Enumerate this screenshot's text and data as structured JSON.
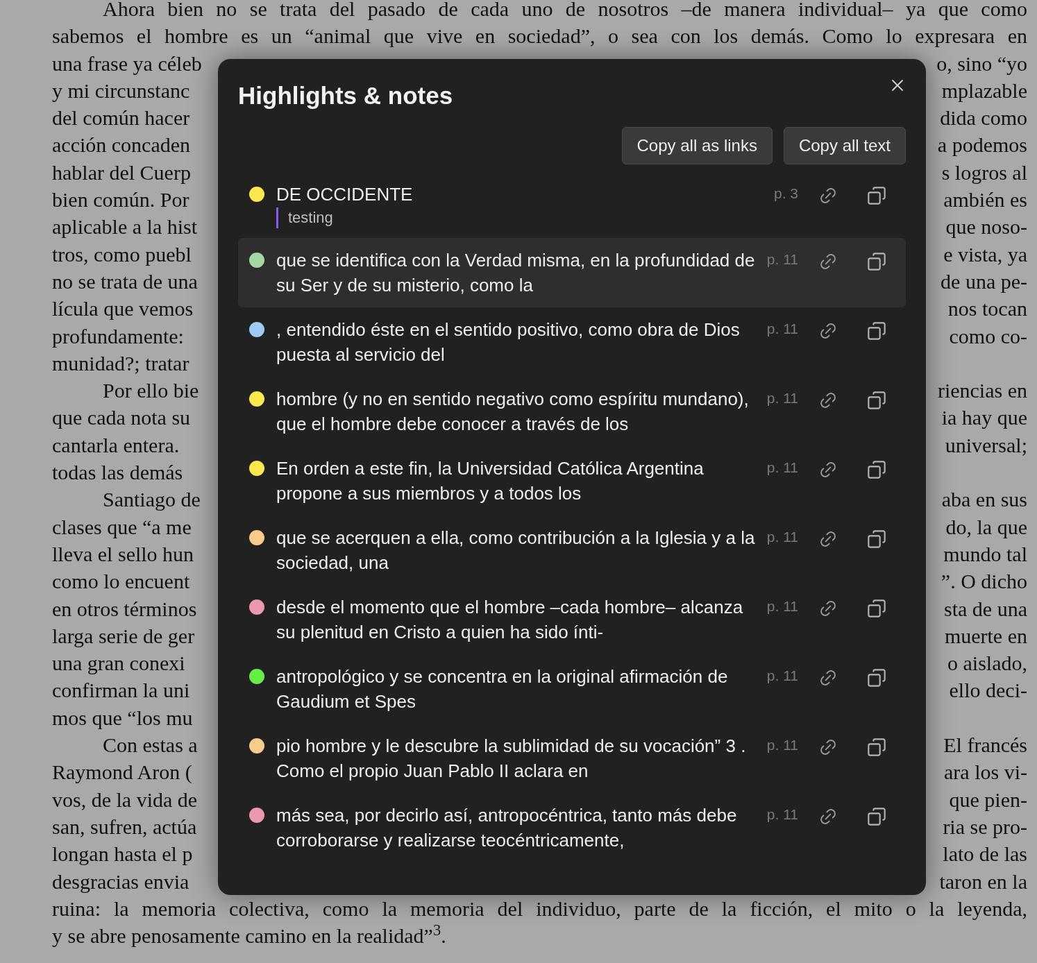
{
  "document": {
    "lines": [
      {
        "kind": "full",
        "indent": true,
        "text": "Ahora bien no se trata del pasado de cada uno de nosotros –de manera individual– ya que como"
      },
      {
        "kind": "full",
        "indent": false,
        "text": "sabemos el hombre es un “animal que vive en sociedad”, o sea con los demás. Como lo expresara en"
      },
      {
        "kind": "split",
        "indent": false,
        "left": "una frase ya céleb",
        "right": "o, sino “yo"
      },
      {
        "kind": "split",
        "indent": false,
        "left": "y mi circunstanc",
        "right": "mplazable"
      },
      {
        "kind": "split",
        "indent": false,
        "left": "del común hacer",
        "right": "dida como"
      },
      {
        "kind": "split",
        "indent": false,
        "left": "acción concaden",
        "right": "a podemos"
      },
      {
        "kind": "split",
        "indent": false,
        "left": "hablar del Cuerp",
        "right": "s logros al"
      },
      {
        "kind": "split",
        "indent": false,
        "left": "bien común. Por",
        "right": "ambién es"
      },
      {
        "kind": "split",
        "indent": false,
        "left": "aplicable a la hist",
        "right": "que noso-"
      },
      {
        "kind": "split",
        "indent": false,
        "left": "tros, como puebl",
        "right": "e vista, ya"
      },
      {
        "kind": "split",
        "indent": false,
        "left": "no se trata de una",
        "right": "de una pe-"
      },
      {
        "kind": "split",
        "indent": false,
        "left": "lícula que vemos",
        "right": "nos tocan"
      },
      {
        "kind": "split",
        "indent": false,
        "left": "profundamente:",
        "right": "como co-"
      },
      {
        "kind": "split",
        "indent": false,
        "left": "munidad?; tratar"
      },
      {
        "kind": "split",
        "indent": true,
        "left": "Por ello bie",
        "right": "riencias en"
      },
      {
        "kind": "split",
        "indent": false,
        "left": "que cada nota su",
        "right": "ia hay que"
      },
      {
        "kind": "split",
        "indent": false,
        "left": "cantarla entera.",
        "right": "universal;"
      },
      {
        "kind": "split",
        "indent": false,
        "left": "todas las demás"
      },
      {
        "kind": "split",
        "indent": true,
        "left": "Santiago de",
        "right": "aba en sus"
      },
      {
        "kind": "split",
        "indent": false,
        "left": "clases que “a me",
        "right": "do, la que"
      },
      {
        "kind": "split",
        "indent": false,
        "left": "lleva el sello hun",
        "right": "mundo tal"
      },
      {
        "kind": "split",
        "indent": false,
        "left": "como lo encuent",
        "right": "”. O dicho"
      },
      {
        "kind": "split",
        "indent": false,
        "left": "en otros términos",
        "right": "sta de una"
      },
      {
        "kind": "split",
        "indent": false,
        "left": "larga serie de ger",
        "right": "muerte en"
      },
      {
        "kind": "split",
        "indent": false,
        "left": "una gran conexi",
        "right": "o aislado,"
      },
      {
        "kind": "split",
        "indent": false,
        "left": "confirman la uni",
        "right": "ello deci-"
      },
      {
        "kind": "split",
        "indent": false,
        "left": "mos que “los mu"
      },
      {
        "kind": "split",
        "indent": true,
        "left": "Con estas a",
        "right": "El francés"
      },
      {
        "kind": "split",
        "indent": false,
        "left": "Raymond Aron (",
        "right": "ara los vi-"
      },
      {
        "kind": "split",
        "indent": false,
        "left": "vos, de la vida de",
        "right": "que pien-"
      },
      {
        "kind": "split",
        "indent": false,
        "left": "san, sufren, actúa",
        "right": "ria se pro-"
      },
      {
        "kind": "split",
        "indent": false,
        "left": "longan hasta el p",
        "right": "lato de las"
      },
      {
        "kind": "split",
        "indent": false,
        "left": "desgracias envia",
        "right": "taron en la"
      },
      {
        "kind": "full",
        "indent": false,
        "text": "ruina: la memoria colectiva, como la memoria del individuo, parte de la ficción, el mito o la leyenda,"
      },
      {
        "kind": "last",
        "indent": false,
        "text": "y se abre penosamente camino en la realidad”$^{3}$."
      }
    ]
  },
  "dialog": {
    "title": "Highlights & notes",
    "buttons": [
      "Copy all as links",
      "Copy all text"
    ],
    "highlights": [
      {
        "text": "DE OCCIDENTE",
        "note": "testing",
        "page": "p. 3",
        "color": "#fbe84e",
        "selected": false
      },
      {
        "text": "que se identifica con la Verdad misma, en la profundidad de su Ser y de su misterio, como la",
        "page": "p. 11",
        "color": "#a6d6a3",
        "selected": true
      },
      {
        "text": ", entendido éste en el sentido positivo, como obra de Dios puesta al servicio del",
        "page": "p. 11",
        "color": "#9dcbf6",
        "selected": false
      },
      {
        "text": "hombre (y no en sentido negativo como espíritu mundano), que el hombre debe conocer a través de los",
        "page": "p. 11",
        "color": "#fbe84e",
        "selected": false
      },
      {
        "text": "En orden a este fin, la Universidad Católica Argentina propone a sus miembros y a todos los",
        "page": "p. 11",
        "color": "#fbe84e",
        "selected": false
      },
      {
        "text": "que se acerquen a ella, como contribución a la Iglesia y a la sociedad, una",
        "page": "p. 11",
        "color": "#f6cb8c",
        "selected": false
      },
      {
        "text": "desde el momento que el hombre –cada hombre– alcanza su plenitud en Cristo a quien ha sido ínti-",
        "page": "p. 11",
        "color": "#eb98b0",
        "selected": false
      },
      {
        "text": "antropológico y se concentra en la original afirmación de Gaudium et Spes",
        "page": "p. 11",
        "color": "#66ee47",
        "selected": false
      },
      {
        "text": "pio hombre y le descubre la sublimidad de su vocación” 3 . Como el propio Juan Pablo II aclara en",
        "page": "p. 11",
        "color": "#f6cb8c",
        "selected": false
      },
      {
        "text": "más sea, por decirlo así, antropocéntrica, tanto más debe corroborarse y realizarse teocéntricamente,",
        "page": "p. 11",
        "color": "#eb98b0",
        "selected": false
      }
    ]
  }
}
